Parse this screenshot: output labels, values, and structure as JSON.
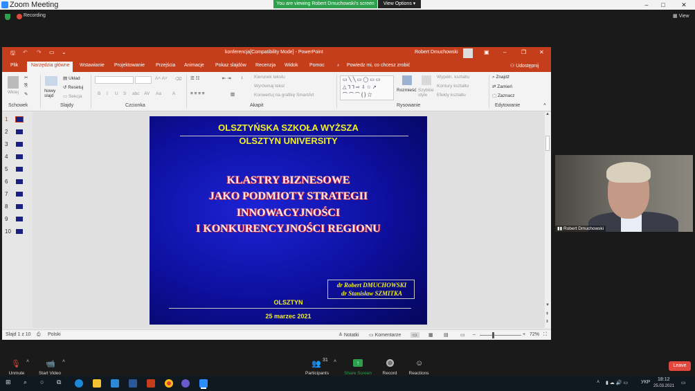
{
  "zoom": {
    "window_title": "Zoom Meeting",
    "viewing_banner": "You are viewing Robert Dmuchowski's screen",
    "view_options": "View Options",
    "recording": "Recording",
    "view": "View",
    "controls": {
      "minimize": "–",
      "maximize": "□",
      "close": "✕"
    }
  },
  "powerpoint": {
    "document_title": "konferencja[Compatibility Mode]  -  PowerPoint",
    "user": "Robert Dmuchowski",
    "tabs": [
      "Plik",
      "Narzędzia główne",
      "Wstawianie",
      "Projektowanie",
      "Przejścia",
      "Animacje",
      "Pokaz slajdów",
      "Recenzja",
      "Widok",
      "Pomoc"
    ],
    "tell_me": "Powiedz mi, co chcesz zrobić",
    "share": "Udostępnij",
    "ribbon": {
      "paste": "Wklej",
      "new_slide": "Nowy slajd",
      "layout": "Układ",
      "reset": "Resetuj",
      "section": "Sekcja",
      "text_direction": "Kierunek tekstu",
      "align_text": "Wyrównaj tekst",
      "smartart": "Konwertuj na grafikę SmartArt",
      "arrange": "Rozmieść",
      "quick_styles": "Szybkie style",
      "shape_fill": "Wypełn. kształtu",
      "shape_outline": "Kontury kształtu",
      "shape_effects": "Efekty kształtu",
      "find": "Znajdź",
      "replace": "Zamień",
      "select": "Zaznacz",
      "bold": "B",
      "italic": "I",
      "underline": "U",
      "shadow": "S",
      "strike": "abc"
    },
    "groups": [
      "Schowek",
      "Slajdy",
      "Czcionka",
      "Akapit",
      "Rysowanie",
      "Edytowanie"
    ],
    "slide_numbers": [
      "1",
      "2",
      "3",
      "4",
      "5",
      "6",
      "7",
      "8",
      "9",
      "10"
    ],
    "status": {
      "slide_count": "Slajd 1 z 10",
      "language": "Polski",
      "notes": "Notatki",
      "comments": "Komentarze",
      "zoom": "72%"
    }
  },
  "slide": {
    "school_pl": "OLSZTYŃSKA SZKOŁA WYŻSZA",
    "school_en": "OLSZTYN UNIVERSITY",
    "title_lines": [
      "KLASTRY BIZNESOWE",
      "JAKO PODMIOTY STRATEGII",
      "INNOWACYJNOŚCI",
      "I KONKURENCYJNOŚCI REGIONU"
    ],
    "author1": "dr Robert DMUCHOWSKI",
    "author2": "dr Stanisław SZMITKA",
    "city": "OLSZTYN",
    "date": "25 marzec 2021"
  },
  "video": {
    "participant_name": "Robert Dmuchowski"
  },
  "toolbar": {
    "unmute": "Unmute",
    "start_video": "Start Video",
    "participants": "Participants",
    "participants_count": "31",
    "share_screen": "Share Screen",
    "record": "Record",
    "reactions": "Reactions",
    "leave": "Leave"
  },
  "taskbar": {
    "language": "УКР",
    "time": "18:12",
    "date": "25.03.2021"
  }
}
